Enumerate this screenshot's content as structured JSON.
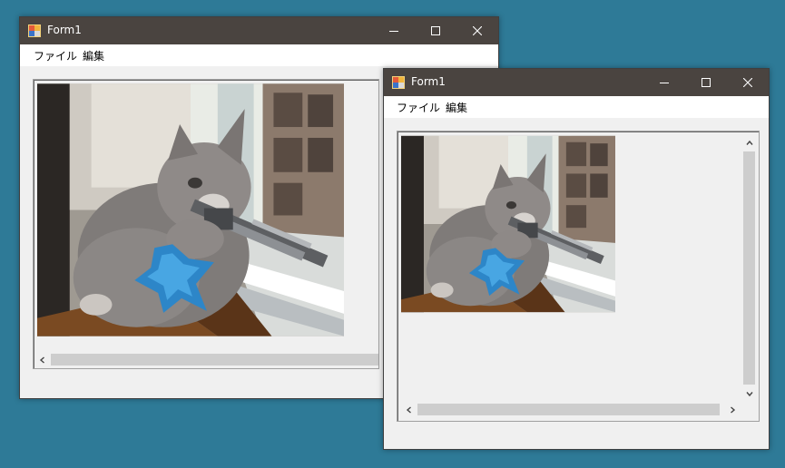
{
  "windows": [
    {
      "title": "Form1",
      "menu": [
        "ファイル",
        "編集"
      ],
      "scrollbars": "horizontal"
    },
    {
      "title": "Form1",
      "menu": [
        "ファイル",
        "編集"
      ],
      "scrollbars": "horizontal-and-vertical"
    }
  ],
  "picture": {
    "subject": "kitten-with-toy-rifle-image"
  },
  "colors": {
    "desktop": "#2e7a97",
    "titlebar": "#4a4440",
    "window": "#f0f0f0",
    "scroll_thumb": "#cdcdcd"
  },
  "icons": {
    "minimize": "minimize-icon",
    "maximize": "maximize-icon",
    "close": "close-icon",
    "scroll_left": "chevron-left-icon",
    "scroll_right": "chevron-right-icon",
    "scroll_up": "chevron-up-icon",
    "scroll_down": "chevron-down-icon"
  }
}
